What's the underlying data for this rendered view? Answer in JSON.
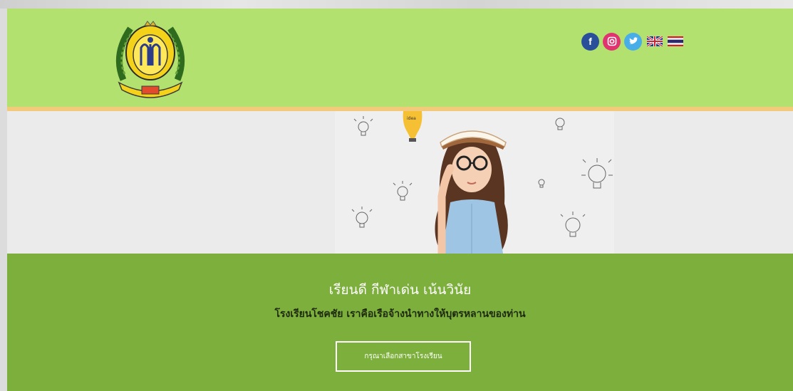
{
  "social": {
    "facebook_glyph": "f",
    "instagram_glyph": "◎",
    "twitter_glyph": "✓",
    "icons": [
      "facebook-icon",
      "instagram-icon",
      "twitter-icon",
      "uk-flag-icon",
      "thai-flag-icon"
    ]
  },
  "hero": {
    "bulb_label": "idea"
  },
  "main": {
    "motto": "เรียนดี กีฬาเด่น เน้นวินัย",
    "tagline": "โรงเรียนโชคชัย เราคือเรือจ้างนำทางให้บุตรหลานของท่าน",
    "select_branch_label": "กรุณาเลือกสาขาโรงเรียน"
  },
  "colors": {
    "header_bg": "#b2e16f",
    "accent_line": "#f3c97a",
    "main_bg": "#7daf3c",
    "facebook": "#2a4f9a",
    "instagram": "#e0336f",
    "twitter": "#49aee8"
  }
}
